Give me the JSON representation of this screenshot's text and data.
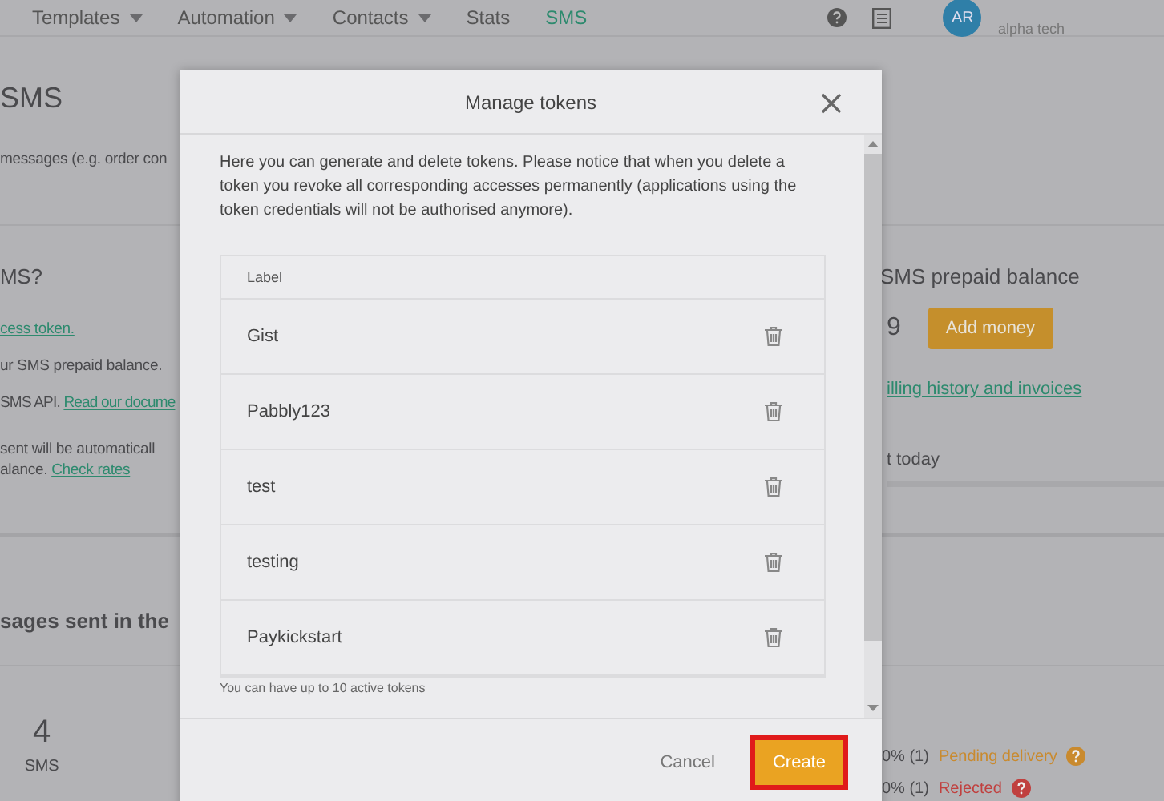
{
  "nav": {
    "items": [
      {
        "label": "Templates",
        "dropdown": true,
        "selected": false
      },
      {
        "label": "Automation",
        "dropdown": true,
        "selected": false
      },
      {
        "label": "Contacts",
        "dropdown": true,
        "selected": false
      },
      {
        "label": "Stats",
        "dropdown": false,
        "selected": false
      },
      {
        "label": "SMS",
        "dropdown": false,
        "selected": true
      }
    ]
  },
  "account": {
    "avatar": "AR",
    "company": "alpha tech"
  },
  "page": {
    "title": "SMS",
    "intro": "messages (e.g. order con",
    "howto": {
      "title": "MS?",
      "lines": [
        [
          {
            "kind": "link",
            "text": "cess token."
          }
        ],
        [
          {
            "kind": "text",
            "text": "ur SMS prepaid balance."
          }
        ],
        [
          {
            "kind": "text",
            "text": "SMS API. "
          },
          {
            "kind": "link",
            "text": "Read our docume"
          }
        ],
        [
          {
            "kind": "text",
            "text": " sent will be automaticall"
          }
        ],
        [
          {
            "kind": "text",
            "text": "alance. "
          },
          {
            "kind": "link",
            "text": "Check rates"
          }
        ]
      ]
    },
    "balance": {
      "title": "SMS prepaid balance",
      "amount": "9",
      "button": "Add money",
      "link": "illing history and invoices",
      "today": "t today"
    },
    "sent": {
      "title": "sages sent in the",
      "count": "4",
      "unit": "SMS",
      "statuses": [
        {
          "share": "0% (1)",
          "label": "Pending delivery",
          "color": "#c98a2e"
        },
        {
          "share": "0% (1)",
          "label": "Rejected",
          "color": "#c0403f"
        }
      ]
    }
  },
  "modal": {
    "title": "Manage tokens",
    "description": "Here you can generate and delete tokens. Please notice that when you delete a token you revoke all corresponding accesses permanently (applications using the token credentials will not be authorised anymore).",
    "column": "Label",
    "tokens": [
      "Gist",
      "Pabbly123",
      "test",
      "testing",
      "Paykickstart"
    ],
    "note": "You can have up to 10 active tokens",
    "cancel": "Cancel",
    "create": "Create"
  }
}
